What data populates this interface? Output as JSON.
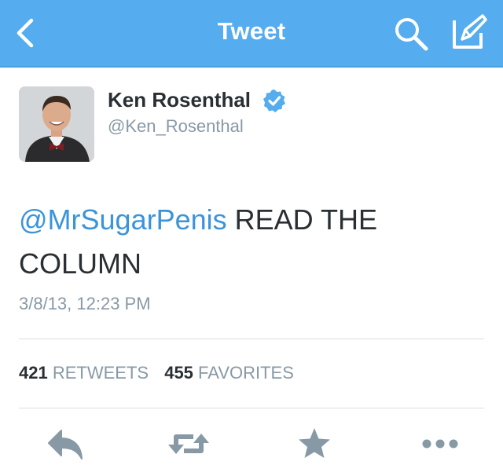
{
  "nav": {
    "title": "Tweet",
    "background": "#55acee"
  },
  "tweet": {
    "author_name": "Ken Rosenthal",
    "author_handle": "@Ken_Rosenthal",
    "verified": true,
    "mention": "@MrSugarPenis",
    "text": " READ THE COLUMN",
    "timestamp": "3/8/13, 12:23 PM"
  },
  "stats": {
    "retweets_count": "421",
    "retweets_label": "RETWEETS",
    "favorites_count": "455",
    "favorites_label": "FAVORITES"
  },
  "actions": [
    "reply-icon",
    "retweet-icon",
    "favorite-icon",
    "more-icon"
  ],
  "colors": {
    "link": "#3b94d9",
    "verified_badge": "#55acee",
    "icon_gray": "#8899a6",
    "text": "#292f33"
  }
}
